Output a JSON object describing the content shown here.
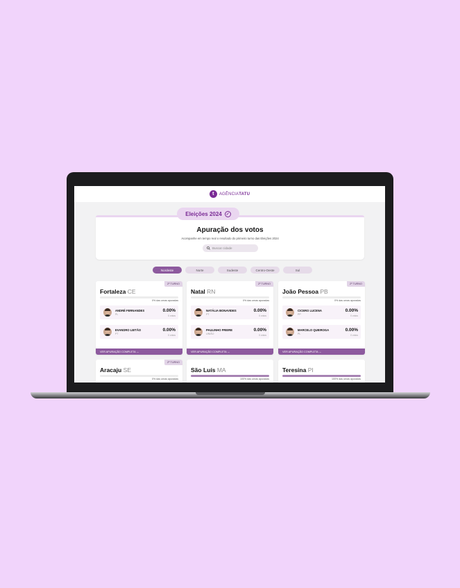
{
  "header": {
    "logo_mark": "t",
    "logo_prefix": "AGÊNCIA",
    "logo_brand": "TATU"
  },
  "hero": {
    "pill_label": "Eleições 2024",
    "title": "Apuração dos votos",
    "subtitle": "Acompanhe em tempo real o resultado do primeiro turno das Eleições 2024",
    "search_placeholder": "Buscar cidade"
  },
  "tabs": [
    {
      "label": "Nordeste",
      "active": true
    },
    {
      "label": "Norte",
      "active": false
    },
    {
      "label": "Sudeste",
      "active": false
    },
    {
      "label": "Centro-Oeste",
      "active": false
    },
    {
      "label": "Sul",
      "active": false
    }
  ],
  "cards": [
    {
      "badge": "2º TURNO",
      "city": "Fortaleza",
      "state": "CE",
      "progress": 0,
      "urnas": "0% das urnas apuradas",
      "candidates": [
        {
          "name": "ANDRÉ FERNANDES",
          "party": "PL",
          "pct": "0.00%",
          "votes": "0 votos"
        },
        {
          "name": "EVANDRO LEITÃO",
          "party": "PT",
          "pct": "0.00%",
          "votes": "0 votos"
        }
      ],
      "footer": "VER APURAÇÃO COMPLETA →"
    },
    {
      "badge": "2º TURNO",
      "city": "Natal",
      "state": "RN",
      "progress": 0,
      "urnas": "0% das urnas apuradas",
      "candidates": [
        {
          "name": "NATÁLIA BONAVIDES",
          "party": "PT",
          "pct": "0.00%",
          "votes": "0 votos"
        },
        {
          "name": "PAULINHO FREIRE",
          "party": "UNIÃO",
          "pct": "0.00%",
          "votes": "0 votos"
        }
      ],
      "footer": "VER APURAÇÃO COMPLETA →"
    },
    {
      "badge": "2º TURNO",
      "city": "João Pessoa",
      "state": "PB",
      "progress": 0,
      "urnas": "0% das urnas apuradas",
      "candidates": [
        {
          "name": "CICERO LUCENA",
          "party": "PP",
          "pct": "0.00%",
          "votes": "0 votos"
        },
        {
          "name": "MARCELO QUEIROGA",
          "party": "PL",
          "pct": "0.00%",
          "votes": "0 votos"
        }
      ],
      "footer": "VER APURAÇÃO COMPLETA →"
    },
    {
      "badge": "2º TURNO",
      "city": "Aracaju",
      "state": "SE",
      "progress": 0,
      "urnas": "0% das urnas apuradas"
    },
    {
      "badge": "",
      "city": "São Luís",
      "state": "MA",
      "progress": 100,
      "urnas": "100% das urnas apuradas"
    },
    {
      "badge": "",
      "city": "Teresina",
      "state": "PI",
      "progress": 100,
      "urnas": "100% das urnas apuradas"
    }
  ],
  "colors": {
    "accent": "#8d5a9e",
    "brand": "#7a2b95",
    "page_bg": "#f1d4fb"
  }
}
